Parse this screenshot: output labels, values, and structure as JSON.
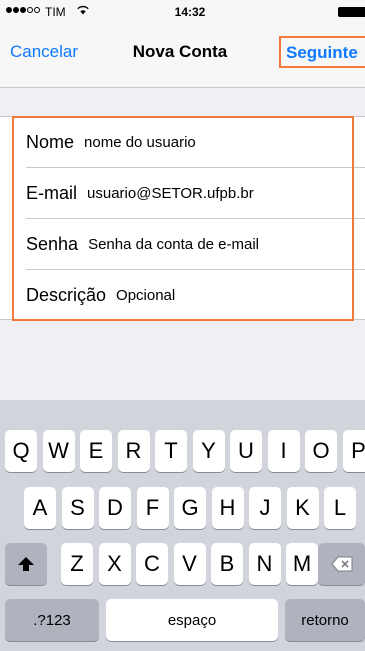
{
  "status_bar": {
    "carrier": "TIM",
    "time": "14:32"
  },
  "nav": {
    "cancel": "Cancelar",
    "title": "Nova Conta",
    "next": "Seguinte"
  },
  "form": {
    "fields": [
      {
        "label": "Nome",
        "placeholder": "nome do usuario"
      },
      {
        "label": "E-mail",
        "placeholder": "usuario@SETOR.ufpb.br"
      },
      {
        "label": "Senha",
        "placeholder": "Senha da conta de e-mail"
      },
      {
        "label": "Descrição",
        "placeholder": "Opcional"
      }
    ]
  },
  "keyboard": {
    "row1": [
      "Q",
      "W",
      "E",
      "R",
      "T",
      "Y",
      "U",
      "I",
      "O",
      "P"
    ],
    "row2": [
      "A",
      "S",
      "D",
      "F",
      "G",
      "H",
      "J",
      "K",
      "L"
    ],
    "row3": [
      "Z",
      "X",
      "C",
      "V",
      "B",
      "N",
      "M"
    ],
    "numbers_key": ".?123",
    "space_key": "espaço",
    "return_key": "retorno",
    "shift_icon": "shift-arrow-icon",
    "delete_icon": "backspace-icon"
  },
  "colors": {
    "accent": "#0e7afe",
    "highlight": "#f3793a"
  }
}
